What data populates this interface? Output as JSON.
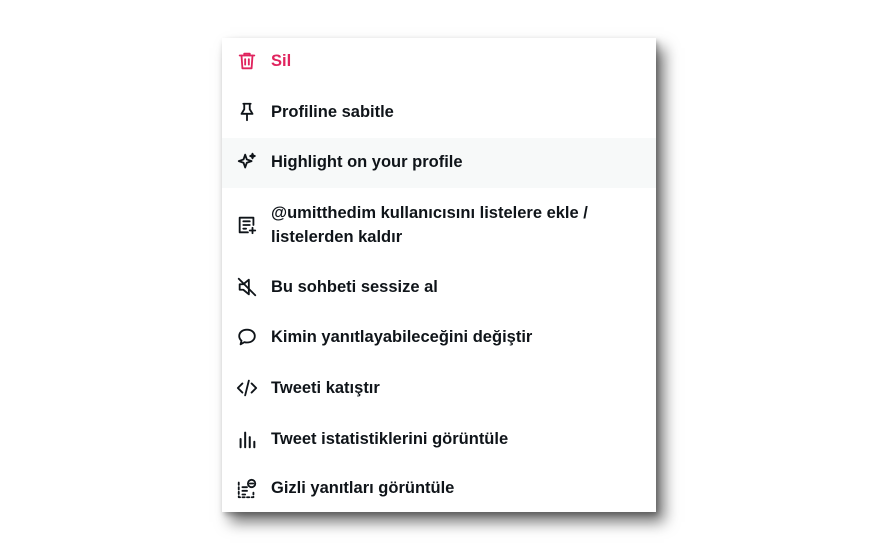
{
  "colors": {
    "danger": "#e0245e",
    "text": "#0f1419",
    "hover_bg": "#f7f9f9"
  },
  "menu": {
    "items": [
      {
        "label": "Sil",
        "icon": "trash-icon"
      },
      {
        "label": "Profiline sabitle",
        "icon": "pin-icon"
      },
      {
        "label": "Highlight on your profile",
        "icon": "sparkle-icon"
      },
      {
        "label_line1": "@umitthedim kullanıcısını listelere ekle /",
        "label_line2": "listelerden kaldır",
        "icon": "list-add-icon"
      },
      {
        "label": "Bu sohbeti sessize al",
        "icon": "mute-icon"
      },
      {
        "label": "Kimin yanıtlayabileceğini değiştir",
        "icon": "speech-bubble-icon"
      },
      {
        "label": "Tweeti katıştır",
        "icon": "code-icon"
      },
      {
        "label": "Tweet istatistiklerini görüntüle",
        "icon": "analytics-icon"
      },
      {
        "label": "Gizli yanıtları görüntüle",
        "icon": "hidden-replies-icon"
      }
    ]
  }
}
